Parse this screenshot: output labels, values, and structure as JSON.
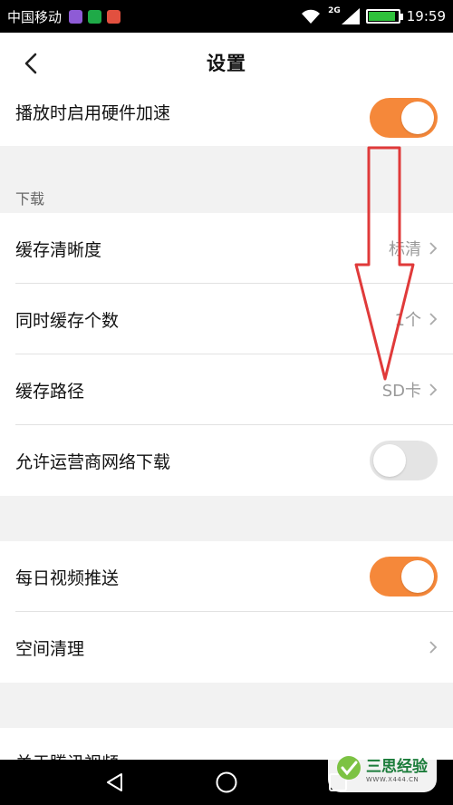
{
  "status_bar": {
    "carrier": "中国移动",
    "network_badge": "2G",
    "time": "19:59",
    "battery_level": 0.9,
    "battery_color": "#2fc13b"
  },
  "header": {
    "back_icon": "chevron-left-icon",
    "title": "设置"
  },
  "settings": {
    "hardware_accel": {
      "label": "播放时启用硬件加速",
      "enabled": true
    },
    "download_section": "下载",
    "cache_quality": {
      "label": "缓存清晰度",
      "value": "标清"
    },
    "concurrent_cache": {
      "label": "同时缓存个数",
      "value": "1个"
    },
    "cache_path": {
      "label": "缓存路径",
      "value": "SD卡"
    },
    "carrier_download": {
      "label": "允许运营商网络下载",
      "enabled": false
    },
    "daily_push": {
      "label": "每日视频推送",
      "enabled": true
    },
    "space_clean": {
      "label": "空间清理"
    },
    "about": {
      "label": "关于腾讯视频"
    }
  },
  "colors": {
    "toggle_on": "#f5883a",
    "toggle_off": "#e4e4e4",
    "annotation": "#e03a3a"
  },
  "nav_bar": {
    "icons": [
      "back-triangle-icon",
      "home-circle-icon",
      "recent-square-icon"
    ]
  },
  "watermark": {
    "text": "三思经验",
    "url": "WWW.X444.CN"
  }
}
